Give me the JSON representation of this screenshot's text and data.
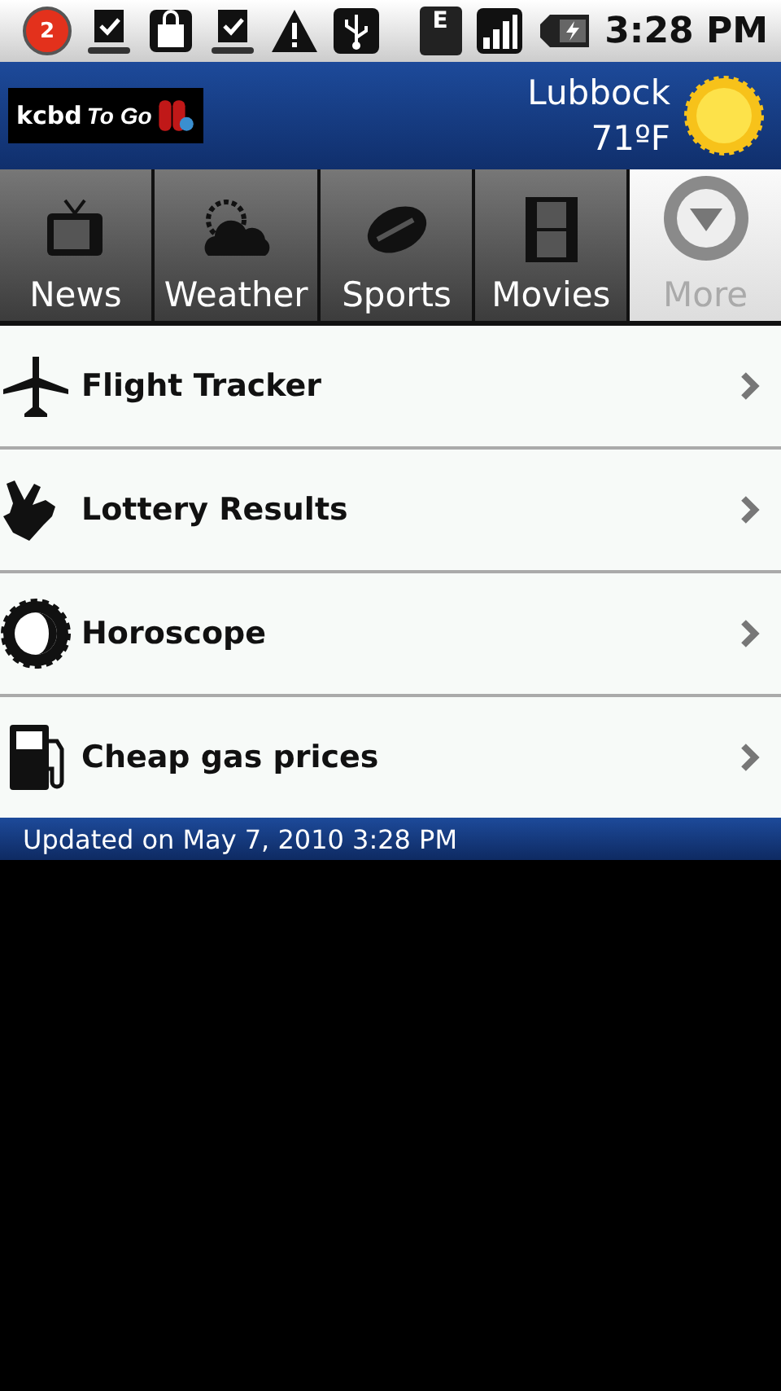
{
  "status_bar": {
    "notification_count": "2",
    "network_label": "E",
    "time": "3:28 PM"
  },
  "header": {
    "logo": {
      "name": "kcbd",
      "tagline": "To Go"
    },
    "city": "Lubbock",
    "temperature": "71ºF"
  },
  "tabs": [
    {
      "label": "News",
      "selected": false
    },
    {
      "label": "Weather",
      "selected": false
    },
    {
      "label": "Sports",
      "selected": false
    },
    {
      "label": "Movies",
      "selected": false
    },
    {
      "label": "More",
      "selected": true
    }
  ],
  "items": [
    {
      "label": "Flight Tracker"
    },
    {
      "label": "Lottery Results"
    },
    {
      "label": "Horoscope"
    },
    {
      "label": "Cheap gas prices"
    }
  ],
  "footer": {
    "updated": "Updated on May 7, 2010 3:28 PM"
  }
}
